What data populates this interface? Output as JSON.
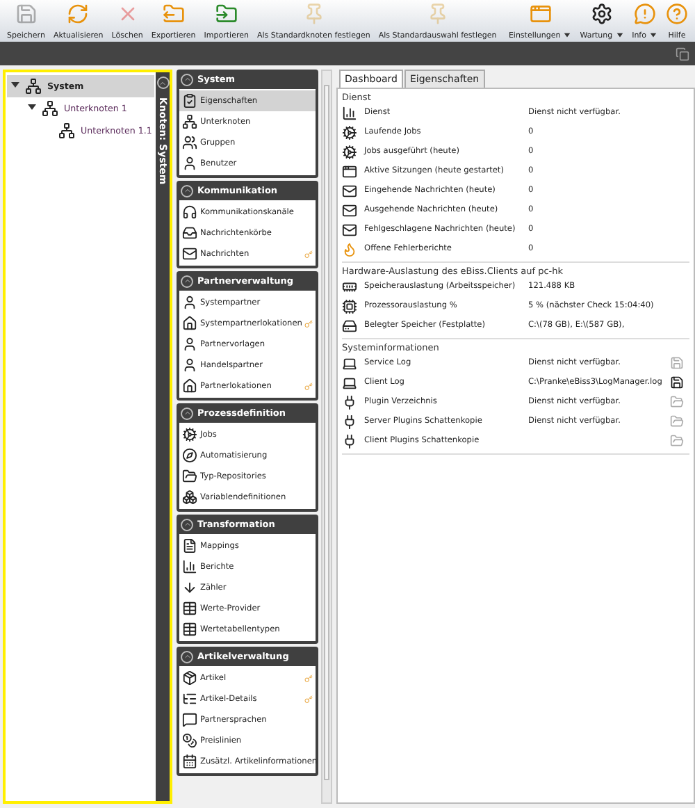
{
  "toolbar": {
    "buttons": [
      {
        "label": "Speichern",
        "kind": "save",
        "disabled": true,
        "dropdown": false
      },
      {
        "label": "Aktualisieren",
        "kind": "refresh",
        "disabled": false,
        "dropdown": false
      },
      {
        "label": "Löschen",
        "kind": "delete",
        "disabled": true,
        "dropdown": false
      },
      {
        "label": "Exportieren",
        "kind": "export",
        "disabled": false,
        "dropdown": false
      },
      {
        "label": "Importieren",
        "kind": "import",
        "disabled": false,
        "dropdown": false
      },
      {
        "label": "Als Standardknoten festlegen",
        "kind": "pin",
        "disabled": true,
        "dropdown": false
      },
      {
        "label": "Als Standardauswahl festlegen",
        "kind": "pin",
        "disabled": true,
        "dropdown": false
      }
    ],
    "right_buttons": [
      {
        "label": "Einstellungen",
        "kind": "window",
        "disabled": false,
        "dropdown": true
      },
      {
        "label": "Wartung",
        "kind": "gear",
        "disabled": false,
        "dropdown": true
      },
      {
        "label": "Info",
        "kind": "info",
        "disabled": false,
        "dropdown": true
      },
      {
        "label": "Hilfe",
        "kind": "help",
        "disabled": false,
        "dropdown": false
      }
    ]
  },
  "tree": [
    {
      "label": "System",
      "selected": true,
      "expanded": true,
      "children": [
        {
          "label": "Unterknoten 1",
          "selected": false,
          "expanded": true,
          "children": [
            {
              "label": "Unterknoten 1.1",
              "selected": false
            }
          ]
        }
      ]
    }
  ],
  "side_strip": {
    "title": "Knoten: System"
  },
  "categories": [
    {
      "title": "System",
      "expanded": true,
      "items": [
        {
          "label": "Eigenschaften",
          "kind": "clipboard",
          "selected": true,
          "filter": false
        },
        {
          "label": "Unterknoten",
          "kind": "nodes",
          "selected": false,
          "filter": false
        },
        {
          "label": "Gruppen",
          "kind": "group",
          "selected": false,
          "filter": false
        },
        {
          "label": "Benutzer",
          "kind": "user",
          "selected": false,
          "filter": false
        }
      ]
    },
    {
      "title": "Kommunikation",
      "expanded": true,
      "items": [
        {
          "label": "Kommunikationskanäle",
          "kind": "channel",
          "selected": false,
          "filter": false
        },
        {
          "label": "Nachrichtenkörbe",
          "kind": "inbox",
          "selected": false,
          "filter": false
        },
        {
          "label": "Nachrichten",
          "kind": "mail",
          "selected": false,
          "filter": true
        }
      ]
    },
    {
      "title": "Partnerverwaltung",
      "expanded": true,
      "items": [
        {
          "label": "Systempartner",
          "kind": "user",
          "selected": false,
          "filter": false
        },
        {
          "label": "Systempartnerlokationen",
          "kind": "home",
          "selected": false,
          "filter": true
        },
        {
          "label": "Partnervorlagen",
          "kind": "user",
          "selected": false,
          "filter": false
        },
        {
          "label": "Handelspartner",
          "kind": "user",
          "selected": false,
          "filter": false
        },
        {
          "label": "Partnerlokationen",
          "kind": "home",
          "selected": false,
          "filter": true
        }
      ]
    },
    {
      "title": "Prozessdefinition",
      "expanded": true,
      "items": [
        {
          "label": "Jobs",
          "kind": "gear",
          "selected": false,
          "filter": false
        },
        {
          "label": "Automatisierung",
          "kind": "compass",
          "selected": false,
          "filter": false
        },
        {
          "label": "Typ-Repositories",
          "kind": "folder",
          "selected": false,
          "filter": false
        },
        {
          "label": "Variablendefinitionen",
          "kind": "cubes",
          "selected": false,
          "filter": false
        }
      ]
    },
    {
      "title": "Transformation",
      "expanded": true,
      "items": [
        {
          "label": "Mappings",
          "kind": "file",
          "selected": false,
          "filter": false
        },
        {
          "label": "Berichte",
          "kind": "chart",
          "selected": false,
          "filter": false
        },
        {
          "label": "Zähler",
          "kind": "counter",
          "selected": false,
          "filter": false
        },
        {
          "label": "Werte-Provider",
          "kind": "table",
          "selected": false,
          "filter": false
        },
        {
          "label": "Wertetabellentypen",
          "kind": "table",
          "selected": false,
          "filter": false
        }
      ]
    },
    {
      "title": "Artikelverwaltung",
      "expanded": true,
      "items": [
        {
          "label": "Artikel",
          "kind": "box",
          "selected": false,
          "filter": true
        },
        {
          "label": "Artikel-Details",
          "kind": "list",
          "selected": false,
          "filter": true
        },
        {
          "label": "Partnersprachen",
          "kind": "speech",
          "selected": false,
          "filter": false
        },
        {
          "label": "Preislinien",
          "kind": "money",
          "selected": false,
          "filter": false
        },
        {
          "label": "Zusätzl. Artikelinformationen",
          "kind": "calendar",
          "selected": false,
          "filter": false
        }
      ]
    }
  ],
  "tabs": [
    {
      "label": "Dashboard",
      "selected": true
    },
    {
      "label": "Eigenschaften",
      "selected": false
    }
  ],
  "dashboard": {
    "sections": [
      {
        "title": "Dienst",
        "rows": [
          {
            "kind": "chart",
            "label": "Dienst",
            "value": "Dienst nicht verfügbar."
          },
          {
            "kind": "gear",
            "label": "Laufende Jobs",
            "value": "0"
          },
          {
            "kind": "gear",
            "label": "Jobs ausgeführt (heute)",
            "value": "0"
          },
          {
            "kind": "window",
            "label": "Aktive Sitzungen (heute gestartet)",
            "value": "0"
          },
          {
            "kind": "mail",
            "label": "Eingehende Nachrichten (heute)",
            "value": "0"
          },
          {
            "kind": "mail",
            "label": "Ausgehende Nachrichten (heute)",
            "value": "0"
          },
          {
            "kind": "mail",
            "label": "Fehlgeschlagene Nachrichten (heute)",
            "value": "0"
          },
          {
            "kind": "flame",
            "label": "Offene Fehlerberichte",
            "value": "0"
          }
        ]
      },
      {
        "title": "Hardware-Auslastung des eBiss.Clients auf pc-hk",
        "rows": [
          {
            "kind": "memory",
            "label": "Speicherauslastung (Arbeitsspeicher)",
            "value": "121.488 KB"
          },
          {
            "kind": "cpu",
            "label": "Prozessorauslastung %",
            "value": "5 % (nächster Check 15:04:40)"
          },
          {
            "kind": "disk",
            "label": "Belegter Speicher (Festplatte)",
            "value": "C:\\(78 GB), E:\\(587 GB),"
          }
        ]
      },
      {
        "title": "Systeminformationen",
        "rows": [
          {
            "kind": "laptop",
            "label": "Service Log",
            "value": "Dienst nicht verfügbar.",
            "enabled": false
          },
          {
            "kind": "laptop",
            "label": "Client Log",
            "value": "C:\\Pranke\\eBiss3\\LogManager.log",
            "enabled": true
          },
          {
            "kind": "plug",
            "label": "Plugin Verzeichnis",
            "value": "Dienst nicht verfügbar.",
            "enabled": false
          },
          {
            "kind": "plug",
            "label": "Server Plugins Schattenkopie",
            "value": "Dienst nicht verfügbar.",
            "enabled": false
          },
          {
            "kind": "plug",
            "label": "Client Plugins Schattenkopie",
            "enabled": false
          }
        ]
      }
    ]
  }
}
